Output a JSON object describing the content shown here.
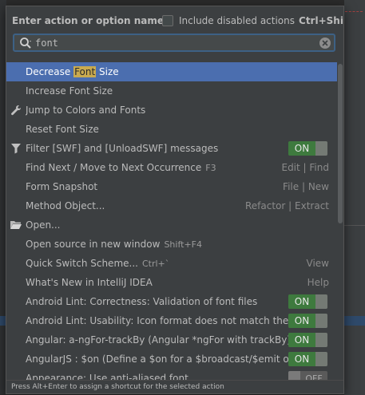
{
  "header": {
    "title": "Enter action or option name:",
    "checkbox_label": "Include disabled actions",
    "checkbox_shortcut": "Ctrl+Shift+A"
  },
  "search": {
    "value": "font"
  },
  "items": [
    {
      "pre": "Decrease ",
      "hl": "Font",
      "post": " Size",
      "selected": true
    },
    {
      "label": "Increase Font Size"
    },
    {
      "label": "Jump to Colors and Fonts",
      "icon": "wrench-icon"
    },
    {
      "label": "Reset Font Size"
    },
    {
      "label": "Filter [SWF] and [UnloadSWF] messages",
      "icon": "filter-icon",
      "toggle": "ON"
    },
    {
      "label": "Find Next / Move to Next Occurrence",
      "shortcut": "F3",
      "right_a": "Edit",
      "right_b": "Find"
    },
    {
      "label": "Form Snapshot",
      "right_a": "File",
      "right_b": "New"
    },
    {
      "label": "Method Object...",
      "right_a": "Refactor",
      "right_b": "Extract"
    },
    {
      "label": "Open...",
      "icon": "folder-icon"
    },
    {
      "label": "Open source in new window",
      "shortcut": "Shift+F4"
    },
    {
      "label": "Quick Switch Scheme...",
      "shortcut": "Ctrl+`",
      "right_a": "View"
    },
    {
      "label": "What's New in IntelliJ IDEA",
      "right_a": "Help"
    },
    {
      "label": "Android Lint: Correctness: Validation of font files",
      "toggle": "ON"
    },
    {
      "label": "Android Lint: Usability: Icon format does not match the file...",
      "toggle": "ON"
    },
    {
      "label": "Angular: a-ngFor-trackBy (Angular *ngFor with trackBy)",
      "toggle": "ON"
    },
    {
      "label": "AngularJS : $on (Define a $on for a $broadcast/$emit on th...",
      "toggle": "ON"
    },
    {
      "label": "Appearance: Use anti-aliased font",
      "toggle": "OFF"
    }
  ],
  "footer": {
    "hint": "Press Alt+Enter to assign a shortcut for the selected action"
  },
  "colors": {
    "selection": "#4b6eaf",
    "highlight": "#c9aa4f",
    "toggle_on": "#3e7a3e"
  }
}
